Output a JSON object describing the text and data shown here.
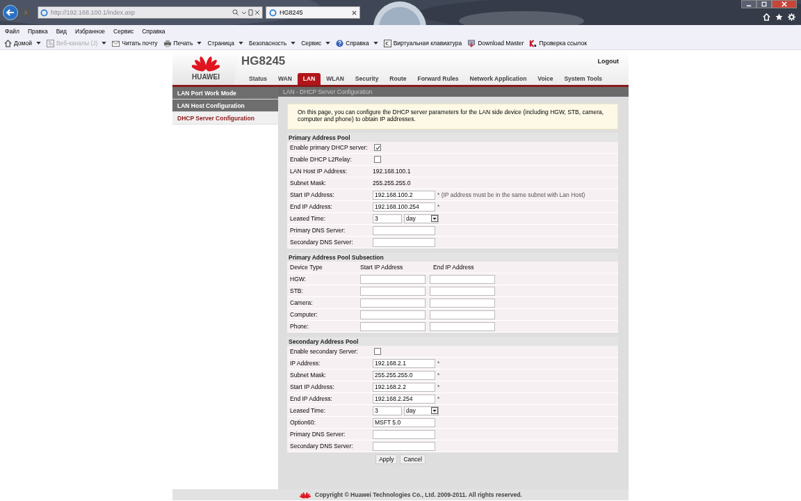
{
  "browser": {
    "address": "http://192.168.100.1/index.asp",
    "tab_title": "HG8245",
    "menu": [
      "Файл",
      "Правка",
      "Вид",
      "Избранное",
      "Сервис",
      "Справка"
    ],
    "toolbar": [
      {
        "label": "Домой",
        "dropdown": true,
        "disabled": false
      },
      {
        "label": "Веб-каналы (J)",
        "dropdown": true,
        "disabled": true
      },
      {
        "label": "Читать почту",
        "dropdown": false,
        "disabled": false
      },
      {
        "label": "Печать",
        "dropdown": true,
        "disabled": false
      },
      {
        "label": "Страница",
        "dropdown": true,
        "disabled": false
      },
      {
        "label": "Безопасность",
        "dropdown": true,
        "disabled": false
      },
      {
        "label": "Сервис",
        "dropdown": true,
        "disabled": false
      },
      {
        "label": "Справка",
        "dropdown": true,
        "disabled": false
      },
      {
        "label": "Виртуальная клавиатура",
        "dropdown": false,
        "disabled": false
      },
      {
        "label": "Download Master",
        "dropdown": false,
        "disabled": false
      },
      {
        "label": "Проверка ссылок",
        "dropdown": false,
        "disabled": false
      }
    ]
  },
  "router": {
    "logo": "HUAWEI",
    "model": "HG8245",
    "logout": "Logout",
    "tabs": [
      {
        "label": "Status",
        "selected": false
      },
      {
        "label": "WAN",
        "selected": false
      },
      {
        "label": "LAN",
        "selected": true
      },
      {
        "label": "WLAN",
        "selected": false
      },
      {
        "label": "Security",
        "selected": false
      },
      {
        "label": "Route",
        "selected": false
      },
      {
        "label": "Forward Rules",
        "selected": false
      },
      {
        "label": "Network Application",
        "selected": false
      },
      {
        "label": "Voice",
        "selected": false
      },
      {
        "label": "System Tools",
        "selected": false
      }
    ],
    "sidebar": [
      {
        "label": "LAN Port Work Mode",
        "selected": false
      },
      {
        "label": "LAN Host Configuration",
        "selected": false
      },
      {
        "label": "DHCP Server Configuration",
        "selected": true
      }
    ],
    "breadcrumb": "LAN - DHCP Server Configuration",
    "info": "On this page, you can configure the DHCP server parameters for the LAN side device (including HGW, STB, camera, computer and phone) to obtain IP addresses.",
    "sections": [
      {
        "kind": "form",
        "title": "Primary Address Pool",
        "rows": [
          {
            "kind": "checkbox",
            "label": "Enable primary DHCP server:",
            "checked": true
          },
          {
            "kind": "checkbox",
            "label": "Enable DHCP L2Relay:",
            "checked": false
          },
          {
            "kind": "text",
            "label": "LAN Host IP Address:",
            "value": "192.168.100.1"
          },
          {
            "kind": "text",
            "label": "Subnet Mask:",
            "value": "255.255.255.0"
          },
          {
            "kind": "input",
            "label": "Start IP Address:",
            "value": "192.168.100.2",
            "note": "* (IP address must be in the same subnet with Lan Host)"
          },
          {
            "kind": "input",
            "label": "End IP Address:",
            "value": "192.168.100.254",
            "note": "*"
          },
          {
            "kind": "lease",
            "label": "Leased Time:",
            "value": "3",
            "unit": "day"
          },
          {
            "kind": "input",
            "label": "Primary DNS Server:"
          },
          {
            "kind": "input",
            "label": "Secondary DNS Server:"
          }
        ]
      },
      {
        "kind": "table",
        "title": "Primary Address Pool Subsection",
        "columns": [
          "Device Type",
          "Start IP Address",
          "End IP Address"
        ],
        "rows": [
          {
            "label": "HGW:"
          },
          {
            "label": "STB:"
          },
          {
            "label": "Camera:"
          },
          {
            "label": "Computer:"
          },
          {
            "label": "Phone:"
          }
        ]
      },
      {
        "kind": "form",
        "title": "Secondary Address Pool",
        "rows": [
          {
            "kind": "checkbox",
            "label": "Enable secondary Server:",
            "checked": false
          },
          {
            "kind": "input",
            "label": "IP Address:",
            "value": "192.168.2.1",
            "note": "*"
          },
          {
            "kind": "input",
            "label": "Subnet Mask:",
            "value": "255.255.255.0",
            "note": "*"
          },
          {
            "kind": "input",
            "label": "Start IP Address:",
            "value": "192.168.2.2",
            "note": "*"
          },
          {
            "kind": "input",
            "label": "End IP Address:",
            "value": "192.168.2.254",
            "note": "*"
          },
          {
            "kind": "lease",
            "label": "Leased Time:",
            "value": "3",
            "unit": "day"
          },
          {
            "kind": "input",
            "label": "Option60:",
            "value": "MSFT 5.0"
          },
          {
            "kind": "input",
            "label": "Primary DNS Server:"
          },
          {
            "kind": "input",
            "label": "Secondary DNS Server:"
          }
        ]
      }
    ],
    "buttons": [
      "Apply",
      "Cancel"
    ],
    "footer": "Copyright © Huawei Technologies Co., Ltd. 2009-2011. All rights reserved."
  }
}
